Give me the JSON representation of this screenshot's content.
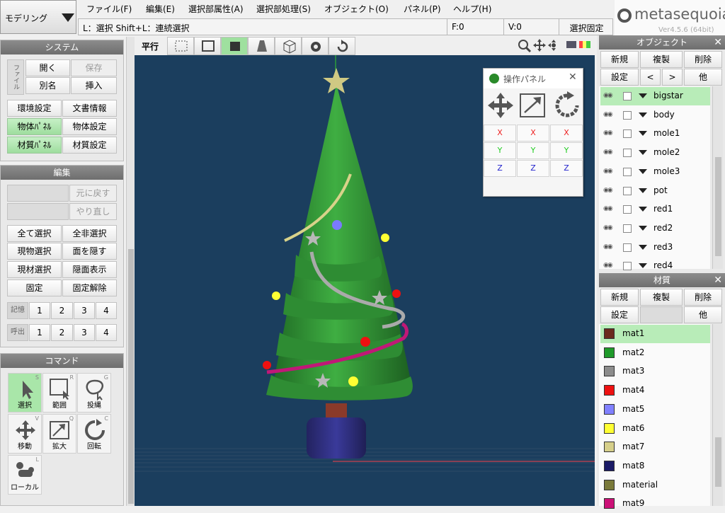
{
  "mode": {
    "label": "モデリング"
  },
  "menu": [
    "ファイル(F)",
    "編集(E)",
    "選択部属性(A)",
    "選択部処理(S)",
    "オブジェクト(O)",
    "パネル(P)",
    "ヘルプ(H)"
  ],
  "status": {
    "hint": "L：選択  Shift+L：連続選択",
    "faces": "F:0",
    "verts": "V:0",
    "fixed": "選択固定"
  },
  "app": {
    "name": "metasequoia4",
    "version": "Ver4.5.6 (64bit)"
  },
  "system": {
    "title": "システム",
    "file_label": "ファイル",
    "open": "開く",
    "save": "保存",
    "save_as": "別名",
    "insert": "挿入",
    "env": "環境設定",
    "doc_info": "文書情報",
    "obj_panel": "物体ﾊﾟﾈﾙ",
    "obj_settings": "物体設定",
    "mat_panel": "材質ﾊﾟﾈﾙ",
    "mat_settings": "材質設定"
  },
  "edit": {
    "title": "編集",
    "undo": "元に戻す",
    "redo": "やり直し",
    "select_all": "全て選択",
    "deselect_all": "全非選択",
    "select_current_obj": "現物選択",
    "hide_faces": "面を隠す",
    "select_current_mat": "現材選択",
    "show_hidden": "隠面表示",
    "fix": "固定",
    "unfix": "固定解除",
    "memory_label": "記憶",
    "recall_label": "呼出",
    "slots": [
      "1",
      "2",
      "3",
      "4"
    ]
  },
  "command": {
    "title": "コマンド",
    "tools": [
      {
        "label": "選択",
        "key": "S"
      },
      {
        "label": "範囲",
        "key": "R"
      },
      {
        "label": "投縄",
        "key": "G"
      },
      {
        "label": "移動",
        "key": "V"
      },
      {
        "label": "拡大",
        "key": "Q"
      },
      {
        "label": "回転",
        "key": "C"
      },
      {
        "label": "ローカル",
        "key": "L"
      }
    ]
  },
  "toolbar": {
    "projection": "平行"
  },
  "op_panel": {
    "title": "操作パネル",
    "axes": [
      "X",
      "X",
      "X",
      "Y",
      "Y",
      "Y",
      "Z",
      "Z",
      "Z"
    ]
  },
  "objects": {
    "title": "オブジェクト",
    "new": "新規",
    "duplicate": "複製",
    "delete": "削除",
    "settings": "設定",
    "prev": "<",
    "next": ">",
    "other": "他",
    "items": [
      "bigstar",
      "body",
      "mole1",
      "mole2",
      "mole3",
      "pot",
      "red1",
      "red2",
      "red3",
      "red4"
    ]
  },
  "materials": {
    "title": "材質",
    "new": "新規",
    "duplicate": "複製",
    "delete": "削除",
    "settings": "設定",
    "other": "他",
    "items": [
      {
        "name": "mat1",
        "color": "#6b2a1e"
      },
      {
        "name": "mat2",
        "color": "#1f9a2a"
      },
      {
        "name": "mat3",
        "color": "#8c8c8c"
      },
      {
        "name": "mat4",
        "color": "#ee1111"
      },
      {
        "name": "mat5",
        "color": "#8080ff"
      },
      {
        "name": "mat6",
        "color": "#ffff33"
      },
      {
        "name": "mat7",
        "color": "#d6cf8a"
      },
      {
        "name": "mat8",
        "color": "#1a1a66"
      },
      {
        "name": "material",
        "color": "#7a7a3a"
      },
      {
        "name": "mat9",
        "color": "#cc1177"
      }
    ]
  },
  "colors": {
    "accent": "#9edd9e",
    "viewport_bg": "#1b3e5e",
    "title_bar": "#7a7a7a"
  }
}
